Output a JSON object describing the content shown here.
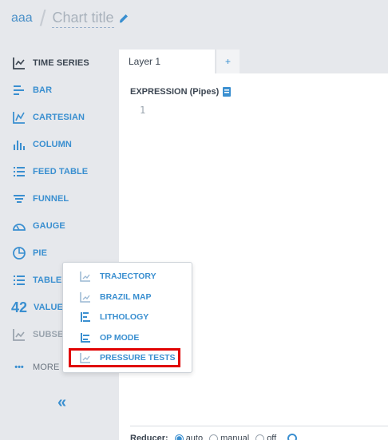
{
  "header": {
    "breadcrumb": "aaa",
    "separator": "/",
    "chart_title": "Chart title"
  },
  "sidebar": {
    "items": [
      {
        "label": "TIME SERIES"
      },
      {
        "label": "BAR"
      },
      {
        "label": "CARTESIAN"
      },
      {
        "label": "COLUMN"
      },
      {
        "label": "FEED TABLE"
      },
      {
        "label": "FUNNEL"
      },
      {
        "label": "GAUGE"
      },
      {
        "label": "PIE"
      },
      {
        "label": "TABLE"
      },
      {
        "label": "VALUE",
        "icon_text": "42"
      },
      {
        "label": "SUBSEA"
      }
    ],
    "more_icon": "•••",
    "more_label": "MORE",
    "collapse_icon": "«"
  },
  "editor": {
    "tab_label": "Layer 1",
    "add_tab_label": "+",
    "expression_label": "EXPRESSION (Pipes)",
    "line_number": "1",
    "reducer_label": "Reducer:",
    "reducer_options": [
      "auto",
      "manual",
      "off"
    ]
  },
  "popup": {
    "items": [
      {
        "label": "TRAJECTORY"
      },
      {
        "label": "BRAZIL MAP"
      },
      {
        "label": "LITHOLOGY"
      },
      {
        "label": "OP MODE"
      },
      {
        "label": "PRESSURE TESTS"
      }
    ]
  },
  "colors": {
    "accent": "#3a8fd0",
    "highlight": "#e00000",
    "sidebar_bg": "#e6e8ec"
  }
}
